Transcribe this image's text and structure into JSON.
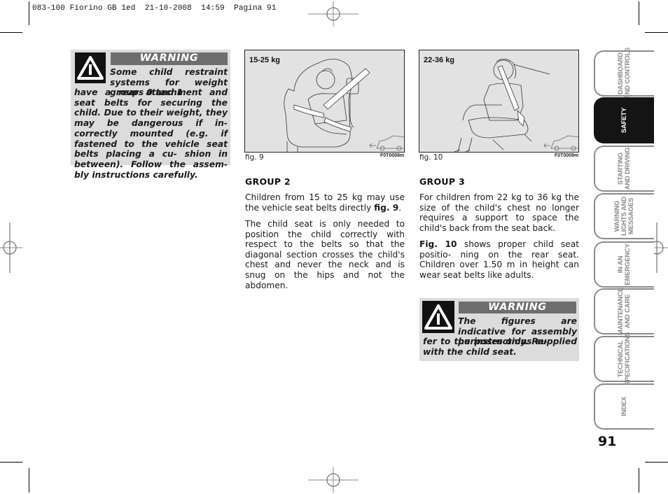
{
  "slug": "083-100 Fiorino GB 1ed  21-10-2008  14:59  Pagina 91",
  "warning1": {
    "title": "WARNING",
    "icon": "warning-triangle-icon",
    "text_first": "Some child restraint systems for weight groups 0 and 1",
    "text_rest": "have a rear attachment and seat belts for securing the child. Due to their weight, they may be dangerous if in- correctly mounted (e.g. if fastened to the vehicle seat belts placing a cu- shion in between). Follow the assem- bly instructions carefully."
  },
  "figures": [
    {
      "weight_label": "15-25 kg",
      "caption": "fig. 9",
      "code": "F0T0008m",
      "illustration": "child-on-booster-seat-with-belt"
    },
    {
      "weight_label": "22-36 kg",
      "caption": "fig. 10",
      "code": "F0T0009m",
      "illustration": "child-on-rear-seat-with-belt"
    }
  ],
  "group2": {
    "heading": "GROUP 2",
    "p1_text": "Children from 15 to 25 kg may use the vehicle seat belts directly ",
    "p1_ref": "fig. 9",
    "p1_end": ".",
    "p2": "The child seat is only needed to position the child correctly with respect to the belts so that the diagonal section crosses the child's chest and never the neck and is snug on the hips and not the abdomen."
  },
  "group3": {
    "heading": "GROUP 3",
    "p1": "For children from 22 kg to 36 kg the size of the child's chest no longer requires a support to space the child's back from the seat back.",
    "p2_ref": "Fig. 10",
    "p2_text": " shows proper child seat positio- ning on the rear seat. Children over 1.50 m in height can wear seat belts like adults."
  },
  "warning2": {
    "title": "WARNING",
    "icon": "warning-triangle-icon",
    "text_first": "The figures are indicative for assembly purposes only. Re-",
    "text_rest": "fer to the instructions supplied with the child seat."
  },
  "side_tabs": [
    {
      "label": "DASHBOARD\nAND CONTROLS",
      "active": false
    },
    {
      "label": "SAFETY",
      "active": true
    },
    {
      "label": "STARTING\nAND DRIVING",
      "active": false
    },
    {
      "label": "WARNING\nLIGHTS AND\nMESSAGES",
      "active": false
    },
    {
      "label": "IN AN\nEMERGENCY",
      "active": false
    },
    {
      "label": "MAINTENANCE\nAND CARE",
      "active": false
    },
    {
      "label": "TECHNICAL\nSPECIFICATIONS",
      "active": false
    },
    {
      "label": "INDEX",
      "active": false
    }
  ],
  "page_number": "91",
  "colors": {
    "warning_bg": "#dcdcdc",
    "warning_title_bg": "#6e6e6e",
    "active_tab": "#141414",
    "tab_border": "#8a8a8a"
  }
}
